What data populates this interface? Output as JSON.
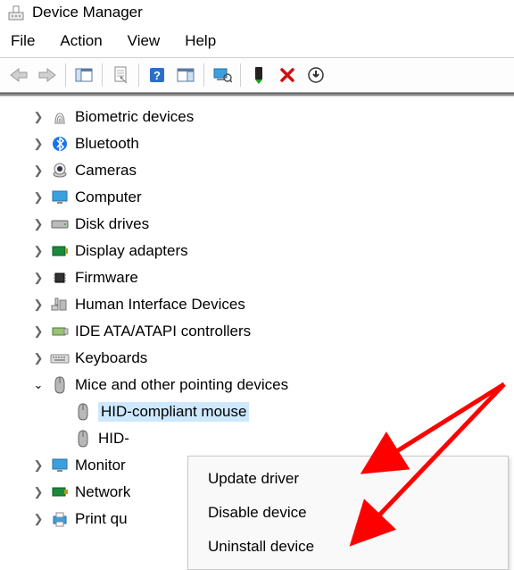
{
  "window": {
    "title": "Device Manager"
  },
  "menubar": {
    "file": "File",
    "action": "Action",
    "view": "View",
    "help": "Help"
  },
  "tree": {
    "items": [
      {
        "label": "Biometric devices",
        "icon": "fingerprint"
      },
      {
        "label": "Bluetooth",
        "icon": "bluetooth"
      },
      {
        "label": "Cameras",
        "icon": "camera"
      },
      {
        "label": "Computer",
        "icon": "monitor"
      },
      {
        "label": "Disk drives",
        "icon": "drive"
      },
      {
        "label": "Display adapters",
        "icon": "display-adapter"
      },
      {
        "label": "Firmware",
        "icon": "chip"
      },
      {
        "label": "Human Interface Devices",
        "icon": "hid"
      },
      {
        "label": "IDE ATA/ATAPI controllers",
        "icon": "ide"
      },
      {
        "label": "Keyboards",
        "icon": "keyboard"
      },
      {
        "label": "Mice and other pointing devices",
        "icon": "mouse",
        "expanded": true
      },
      {
        "label": "Monitors",
        "icon": "monitor-small",
        "truncated": "Monitor"
      },
      {
        "label": "Network adapters",
        "icon": "network",
        "truncated": "Network"
      },
      {
        "label": "Print queues",
        "icon": "printer",
        "truncated": "Print qu"
      }
    ],
    "mouse_children": [
      {
        "label": "HID-compliant mouse",
        "selected": true
      },
      {
        "label": "HID-",
        "selected": false
      }
    ]
  },
  "context_menu": {
    "update": "Update driver",
    "disable": "Disable device",
    "uninstall": "Uninstall device"
  }
}
